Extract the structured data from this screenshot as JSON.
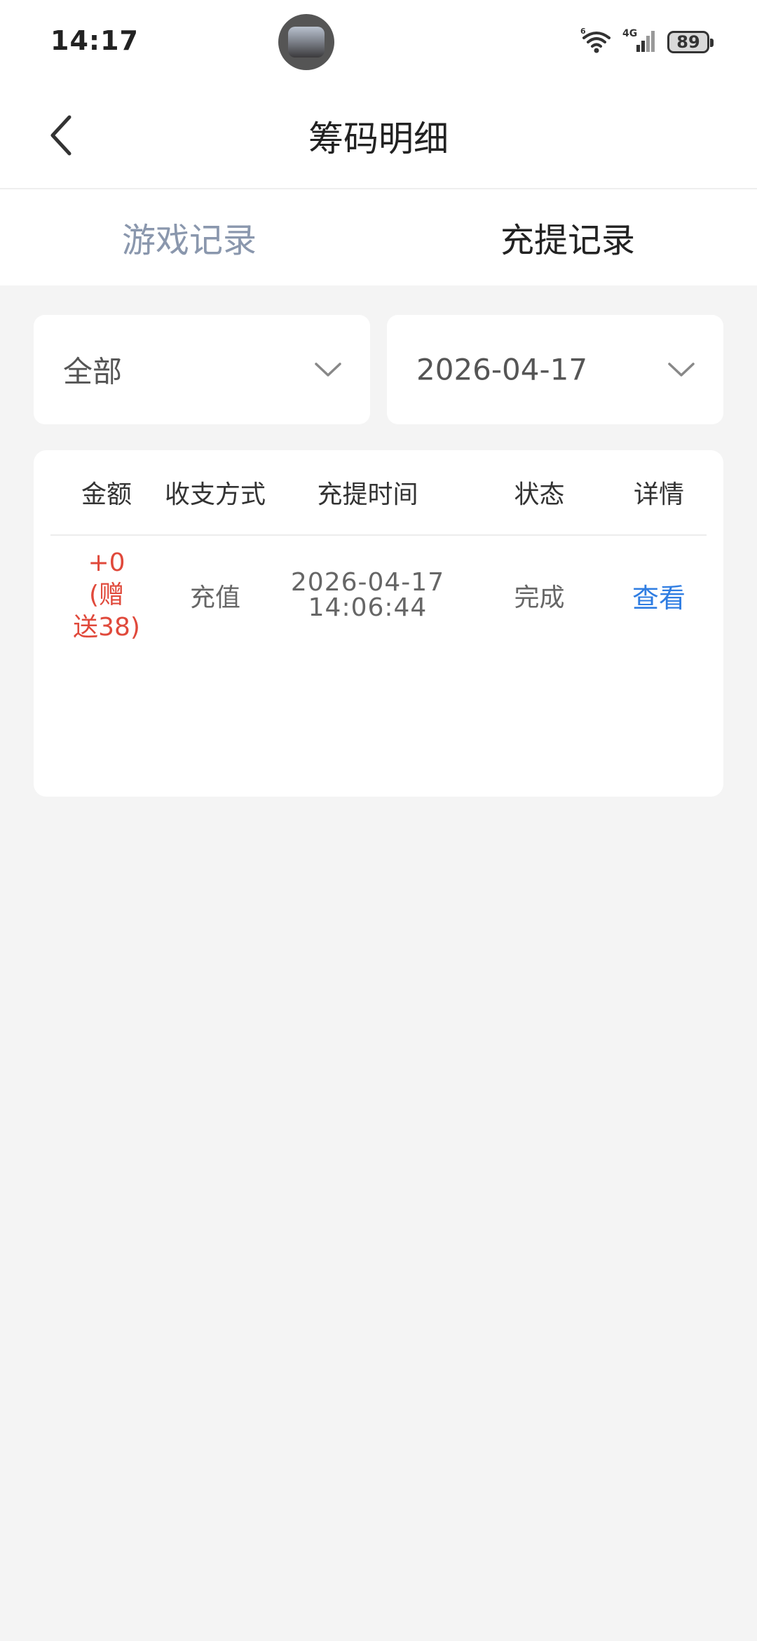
{
  "status_bar": {
    "time": "14:17",
    "network_label": "4G",
    "wifi_label": "6",
    "battery": "89"
  },
  "header": {
    "title": "筹码明细"
  },
  "tabs": [
    {
      "label": "游戏记录",
      "active": false
    },
    {
      "label": "充提记录",
      "active": true
    }
  ],
  "filters": {
    "type": "全部",
    "date": "2026-04-17"
  },
  "table": {
    "columns": [
      "金额",
      "收支方式",
      "充提时间",
      "状态",
      "详情"
    ],
    "rows": [
      {
        "amount": "+0 (赠\n送38)",
        "method": "充值",
        "time": "2026-04-17\n14:06:44",
        "status": "完成",
        "detail": "查看"
      }
    ]
  },
  "colors": {
    "amount": "#e0493b",
    "link": "#2f7de2",
    "inactive_tab": "#8a97ad",
    "background": "#f4f4f4"
  }
}
